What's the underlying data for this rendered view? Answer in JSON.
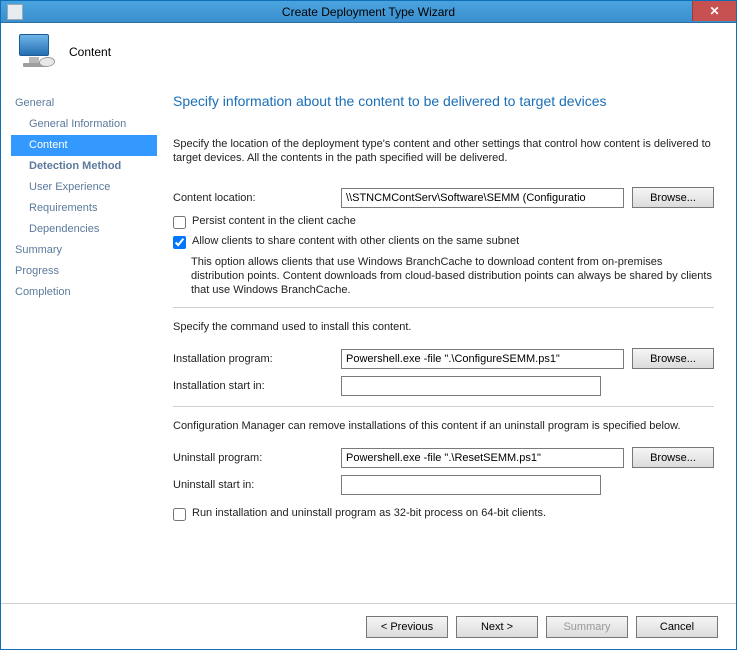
{
  "window": {
    "title": "Create Deployment Type Wizard",
    "header_label": "Content"
  },
  "nav": {
    "items": [
      {
        "label": "General",
        "kind": "top"
      },
      {
        "label": "General Information",
        "kind": "sub"
      },
      {
        "label": "Content",
        "kind": "sub-active"
      },
      {
        "label": "Detection Method",
        "kind": "sub-bold"
      },
      {
        "label": "User Experience",
        "kind": "sub"
      },
      {
        "label": "Requirements",
        "kind": "sub"
      },
      {
        "label": "Dependencies",
        "kind": "sub"
      },
      {
        "label": "Summary",
        "kind": "top"
      },
      {
        "label": "Progress",
        "kind": "top"
      },
      {
        "label": "Completion",
        "kind": "top"
      }
    ]
  },
  "content": {
    "heading": "Specify information about the content to be delivered to target devices",
    "desc": "Specify the location of the deployment type's content and other settings that control how content is delivered to target devices. All the contents in the path specified will be delivered.",
    "location_label": "Content location:",
    "location_value": "\\\\STNCMContServ\\Software\\SEMM (Configuratio",
    "browse": "Browse...",
    "persist_label": "Persist content in the client cache",
    "persist_checked": false,
    "share_label": "Allow clients to share content with other clients on the same subnet",
    "share_checked": true,
    "share_note": "This option allows clients that use Windows BranchCache to download content from on-premises distribution points. Content downloads from cloud-based distribution points can always be shared by clients that use Windows BranchCache.",
    "install_desc": "Specify the command used to install this content.",
    "install_prog_label": "Installation program:",
    "install_prog_value": "Powershell.exe -file \".\\ConfigureSEMM.ps1\"",
    "install_start_label": "Installation start in:",
    "install_start_value": "",
    "uninstall_desc": "Configuration Manager can remove installations of this content if an uninstall program is specified below.",
    "uninstall_prog_label": "Uninstall program:",
    "uninstall_prog_value": "Powershell.exe -file \".\\ResetSEMM.ps1\"",
    "uninstall_start_label": "Uninstall start in:",
    "uninstall_start_value": "",
    "run32_label": "Run installation and uninstall program as 32-bit process on 64-bit clients.",
    "run32_checked": false
  },
  "footer": {
    "previous": "< Previous",
    "next": "Next >",
    "summary": "Summary",
    "cancel": "Cancel"
  }
}
